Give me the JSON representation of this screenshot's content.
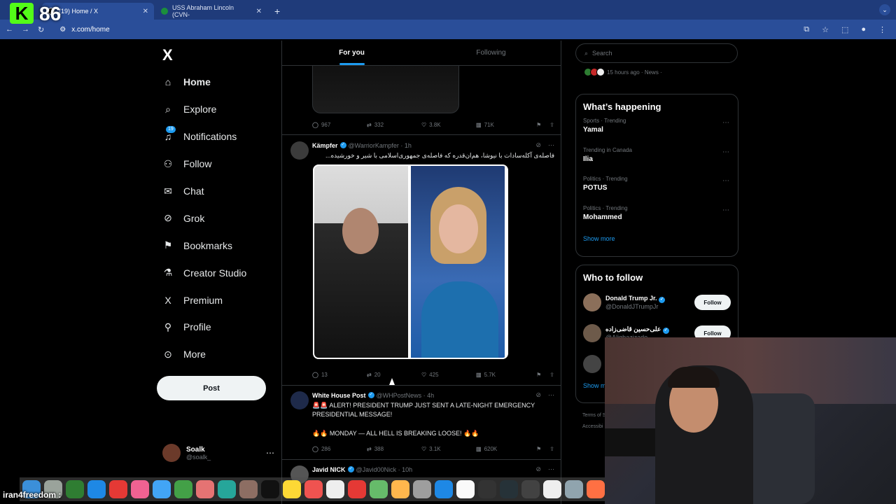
{
  "browser": {
    "tabs": [
      {
        "title": "(19) Home / X",
        "active": true
      },
      {
        "title": "USS Abraham Lincoln (CVN-",
        "active": false
      }
    ],
    "new_tab": "+",
    "url": "x.com/home"
  },
  "overlay": {
    "kick_count": "86",
    "kick_logo": "K",
    "chat_user": "iran4freedom :"
  },
  "sidebar": {
    "logo": "X",
    "items": [
      {
        "label": "Home",
        "icon": "home-icon",
        "glyph": "⌂"
      },
      {
        "label": "Explore",
        "icon": "search-icon",
        "glyph": "⌕"
      },
      {
        "label": "Notifications",
        "icon": "bell-icon",
        "glyph": "🔔",
        "badge": "19"
      },
      {
        "label": "Follow",
        "icon": "person-add-icon",
        "glyph": "👤"
      },
      {
        "label": "Chat",
        "icon": "mail-icon",
        "glyph": "✉"
      },
      {
        "label": "Grok",
        "icon": "grok-icon",
        "glyph": "⊘"
      },
      {
        "label": "Bookmarks",
        "icon": "bookmark-icon",
        "glyph": "🔖"
      },
      {
        "label": "Creator Studio",
        "icon": "flask-icon",
        "glyph": "⚗"
      },
      {
        "label": "Premium",
        "icon": "x-premium-icon",
        "glyph": "X"
      },
      {
        "label": "Profile",
        "icon": "profile-icon",
        "glyph": "👤"
      },
      {
        "label": "More",
        "icon": "more-circle-icon",
        "glyph": "⋯"
      }
    ],
    "post_label": "Post",
    "account": {
      "name": "Soalk",
      "handle": "@soalk_"
    }
  },
  "main": {
    "tabs": [
      {
        "label": "For you",
        "active": true
      },
      {
        "label": "Following",
        "active": false
      }
    ],
    "prev_actions": {
      "replies": "967",
      "reposts": "332",
      "likes": "3.8K",
      "views": "71K"
    },
    "tweets": [
      {
        "name": "Kämpfer",
        "handle": "@WarriorKampfer · 1h",
        "text": "فاصله‌ی آکله‌سادات با نیوشا، هم‌ان‌قدره که فاصله‌ی جمهوری‌اسلامی با شیر و خورشیده...",
        "actions": {
          "replies": "13",
          "reposts": "20",
          "likes": "425",
          "views": "5.7K"
        }
      },
      {
        "name": "White House Post",
        "handle": "@WHPostNews · 4h",
        "text": "🚨🚨 ALERT! PRESIDENT TRUMP JUST SENT A LATE-NIGHT EMERGENCY PRESIDENTIAL MESSAGE!",
        "text2": "🔥🔥 MONDAY — ALL HELL IS BREAKING LOOSE! 🔥🔥",
        "actions": {
          "replies": "286",
          "reposts": "388",
          "likes": "3.1K",
          "views": "620K"
        }
      },
      {
        "name": "Javid NICK",
        "handle": "@Javid00Nick · 10h"
      }
    ]
  },
  "right": {
    "search_placeholder": "Search",
    "news_meta": "15 hours ago · News ·",
    "happening_title": "What’s happening",
    "trends": [
      {
        "category": "Sports · Trending",
        "name": "Yamal"
      },
      {
        "category": "Trending in Canada",
        "name": "Ilia"
      },
      {
        "category": "Politics · Trending",
        "name": "POTUS"
      },
      {
        "category": "Politics · Trending",
        "name": "Mohammed"
      }
    ],
    "show_more": "Show more",
    "who_title": "Who to follow",
    "who": [
      {
        "name": "Donald Trump Jr.",
        "handle": "@DonaldJTrumpJr",
        "button": "Follow"
      },
      {
        "name": "علی‌حسین قاضی‌زاده",
        "handle": "@Alighazizade",
        "button": "Follow"
      }
    ],
    "show_more_2": "Show m",
    "footer1": "Terms of S",
    "footer2": "Accessibi"
  },
  "colors": {
    "accent": "#1d9bf0",
    "background": "#000000",
    "chrome": "#2a4e99",
    "kick": "#53fc18"
  }
}
